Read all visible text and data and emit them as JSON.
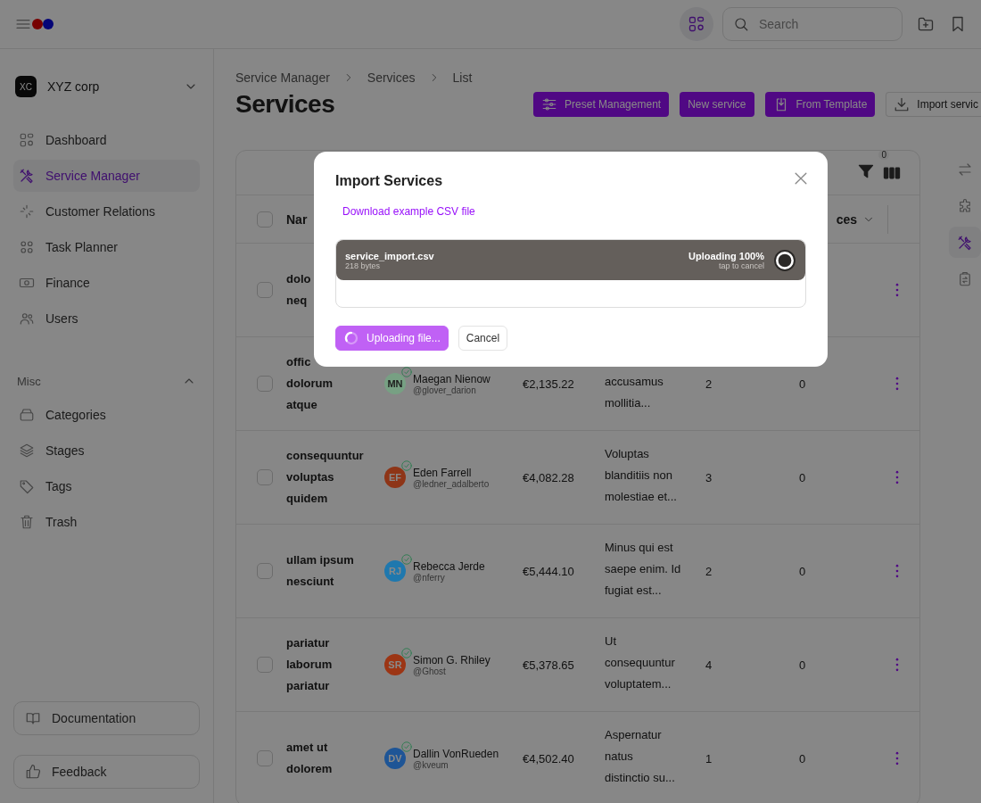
{
  "topbar": {
    "search": {
      "placeholder": "Search"
    }
  },
  "org": {
    "initials": "XC",
    "name": "XYZ corp"
  },
  "nav": [
    {
      "label": "Dashboard",
      "selected": false
    },
    {
      "label": "Service Manager",
      "selected": true
    },
    {
      "label": "Customer Relations",
      "selected": false
    },
    {
      "label": "Task Planner",
      "selected": false
    },
    {
      "label": "Finance",
      "selected": false
    },
    {
      "label": "Users",
      "selected": false
    }
  ],
  "misc": {
    "title": "Misc",
    "expanded": true,
    "items": [
      {
        "label": "Categories",
        "selected": false
      },
      {
        "label": "Stages",
        "selected": false
      },
      {
        "label": "Tags",
        "selected": false
      },
      {
        "label": "Trash",
        "selected": false
      }
    ]
  },
  "footer_buttons": [
    "Documentation",
    "Feedback"
  ],
  "breadcrumb": [
    "Service Manager",
    "Services",
    "List"
  ],
  "title": "Services",
  "actions": [
    {
      "label": "Preset Management",
      "kind": "primary"
    },
    {
      "label": "New service",
      "kind": "primary"
    },
    {
      "label": "From Template",
      "kind": "primary"
    },
    {
      "label": "Import servic",
      "kind": "outline"
    }
  ],
  "table": {
    "filter_count": "0",
    "all_selected": false,
    "columns": [
      "Nar",
      "ces"
    ],
    "rows": [
      {
        "selected": false,
        "name": [
          "dolo",
          "neq"
        ]
      },
      {
        "selected": false,
        "name": [
          "offic",
          "dolorum",
          "atque"
        ],
        "owner": {
          "initials": "MN",
          "name": "Maegan Nienow",
          "handle": "@glover_darion",
          "color": "#77a083",
          "verified": true
        },
        "price": "€2,135.22",
        "description": [
          "accusamus",
          "mollitia..."
        ],
        "column_6": "2",
        "column_7": "0"
      },
      {
        "selected": false,
        "name": [
          "consequuntur",
          "voluptas",
          "quidem"
        ],
        "owner": {
          "initials": "EF",
          "name": "Eden Farrell",
          "handle": "@ledner_adalberto",
          "color": "#8e3517",
          "verified": true
        },
        "price": "€4,082.28",
        "description": [
          "Voluptas",
          "blanditiis non",
          "molestiae et..."
        ],
        "column_6": "3",
        "column_7": "0"
      },
      {
        "selected": false,
        "name": [
          "ullam ipsum",
          "nesciunt"
        ],
        "owner": {
          "initials": "RJ",
          "name": "Rebecca Jerde",
          "handle": "@nferry",
          "color": "#1f78ae",
          "verified": true
        },
        "price": "€5,444.10",
        "description": [
          "Minus qui est",
          "saepe enim. Id",
          "fugiat est..."
        ],
        "column_6": "2",
        "column_7": "0"
      },
      {
        "selected": false,
        "name": [
          "pariatur",
          "laborum",
          "pariatur"
        ],
        "owner": {
          "initials": "SR",
          "name": "Simon G. Rhiley",
          "handle": "@Ghost",
          "color": "#9c3514",
          "verified": true
        },
        "price": "€5,378.65",
        "description": [
          "Ut",
          "consequuntur",
          "voluptatem..."
        ],
        "column_6": "4",
        "column_7": "0"
      },
      {
        "selected": false,
        "name": [
          "amet ut",
          "dolorem"
        ],
        "owner": {
          "initials": "DV",
          "name": "Dallin VonRueden",
          "handle": "@kveum",
          "color": "#1e5596",
          "verified": true
        },
        "price": "€4,502.40",
        "description": [
          "Aspernatur",
          "natus",
          "distinctio su..."
        ],
        "column_6": "1",
        "column_7": "0"
      }
    ]
  },
  "rail": [
    {
      "selected": false
    },
    {
      "selected": false
    },
    {
      "selected": true
    },
    {
      "selected": false
    }
  ],
  "modal": {
    "title": "Import Services",
    "link": "Download example CSV file",
    "file": {
      "name": "service_import.csv",
      "size": "218 bytes",
      "status": "Uploading 100%",
      "hint": "tap to cancel",
      "level": 1
    },
    "buttons": [
      {
        "label": "Uploading file...",
        "kind": "primary",
        "loading": true
      },
      {
        "label": "Cancel",
        "kind": "secondary",
        "loading": false
      }
    ]
  }
}
